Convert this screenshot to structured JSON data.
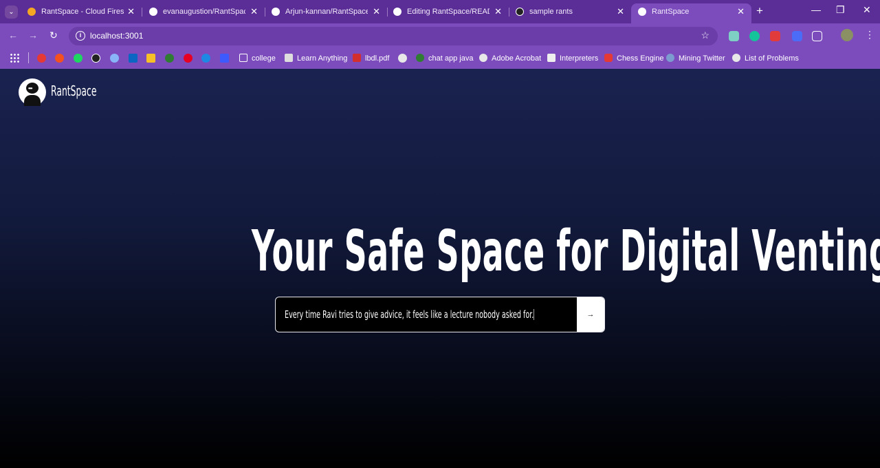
{
  "browser": {
    "tabs": [
      {
        "title": "RantSpace - Cloud Firestore",
        "favicon_color": "#f5a623"
      },
      {
        "title": "evanaugustion/RantSpace",
        "favicon_color": "#ffffff"
      },
      {
        "title": "Arjun-kannan/RantSpace",
        "favicon_color": "#ffffff"
      },
      {
        "title": "Editing RantSpace/README",
        "favicon_color": "#ffffff"
      },
      {
        "title": "sample rants",
        "favicon_color": "#222222"
      },
      {
        "title": "RantSpace",
        "favicon_color": "#ffffff"
      }
    ],
    "tab_close": "✕",
    "new_tab": "+",
    "url": "localhost:3001",
    "bookmarks": [
      {
        "label": "college",
        "icon": "folder-icon"
      },
      {
        "label": "Learn Anything",
        "icon": "stack-icon"
      },
      {
        "label": "lbdl.pdf",
        "icon": "pdf-icon"
      },
      {
        "label": "chat app java",
        "icon": "link-icon"
      },
      {
        "label": "Adobe Acrobat",
        "icon": "globe-icon"
      },
      {
        "label": "Interpreters",
        "icon": "doc-icon"
      },
      {
        "label": "Chess Engine",
        "icon": "youtube-icon"
      },
      {
        "label": "Mining Twitter",
        "icon": "wordpress-icon"
      },
      {
        "label": "List of Problems",
        "icon": "globe-icon"
      }
    ],
    "accent_color": "#7c4cbd",
    "tabbar_color": "#5b2d96"
  },
  "app": {
    "brand": "RantSpace",
    "hero_title": "Your Safe Space for Digital Venting",
    "rant_input_value": "Every time Ravi tries to give advice, it feels like a lecture nobody asked for.",
    "submit_label": "→"
  }
}
